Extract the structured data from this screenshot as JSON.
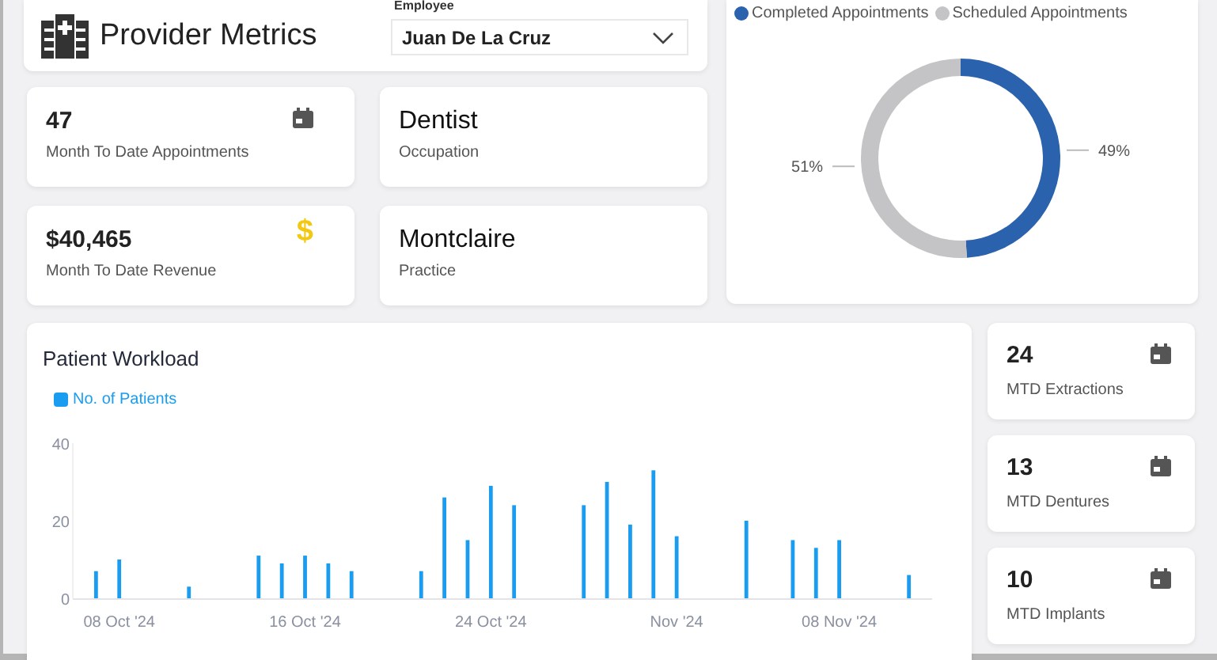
{
  "header": {
    "title": "Provider Metrics",
    "employee": {
      "label": "Employee",
      "value": "Juan De La Cruz"
    }
  },
  "kpis": [
    {
      "value": "47",
      "label": "Month To Date Appointments",
      "icon": {
        "kind": "calendar"
      }
    },
    {
      "value": "Dentist",
      "label": "Occupation"
    },
    {
      "value": "$40,465",
      "label": "Month To Date Revenue",
      "icon": {
        "kind": "glyph",
        "text": "$"
      }
    },
    {
      "value": "Montclaire",
      "label": "Practice"
    }
  ],
  "appointments": {
    "legend": [
      {
        "label": "Completed Appointments",
        "color": "#2b62ad"
      },
      {
        "label": "Scheduled Appointments",
        "color": "#c4c3c6"
      }
    ],
    "chart_data": {
      "type": "donut",
      "values": [
        49,
        51
      ],
      "value_labels": [
        "49%",
        "51%"
      ]
    }
  },
  "workload": {
    "title": "Patient Workload",
    "chart_data": {
      "type": "bar",
      "x": [
        "2024-10-07",
        "2024-10-08",
        "2024-10-11",
        "2024-10-14",
        "2024-10-15",
        "2024-10-16",
        "2024-10-17",
        "2024-10-18",
        "2024-10-21",
        "2024-10-22",
        "2024-10-23",
        "2024-10-24",
        "2024-10-25",
        "2024-10-28",
        "2024-10-29",
        "2024-10-30",
        "2024-10-31",
        "2024-11-01",
        "2024-11-04",
        "2024-11-06",
        "2024-11-07",
        "2024-11-08",
        "2024-11-11"
      ],
      "series": [
        {
          "name": "No. of Patients",
          "color": "#1a9cf0",
          "values": [
            7,
            10,
            3,
            11,
            9,
            11,
            9,
            7,
            7,
            26,
            15,
            29,
            24,
            24,
            30,
            19,
            33,
            16,
            20,
            15,
            13,
            15,
            6
          ]
        }
      ],
      "xlim": [
        "2024-10-06",
        "2024-11-12"
      ],
      "ylim": [
        0,
        40
      ],
      "yticks": [
        0,
        20,
        40
      ],
      "xticks": [
        {
          "value": "2024-10-08",
          "label": "08 Oct '24"
        },
        {
          "value": "2024-10-16",
          "label": "16 Oct '24"
        },
        {
          "value": "2024-10-24",
          "label": "24 Oct '24"
        },
        {
          "value": "2024-11-01",
          "label": "Nov '24"
        },
        {
          "value": "2024-11-08",
          "label": "08 Nov '24"
        }
      ]
    }
  },
  "side_kpis": [
    {
      "value": "24",
      "label": "MTD Extractions",
      "icon": {
        "kind": "calendar"
      }
    },
    {
      "value": "13",
      "label": "MTD Dentures",
      "icon": {
        "kind": "calendar"
      }
    },
    {
      "value": "10",
      "label": "MTD Implants",
      "icon": {
        "kind": "calendar"
      }
    }
  ]
}
